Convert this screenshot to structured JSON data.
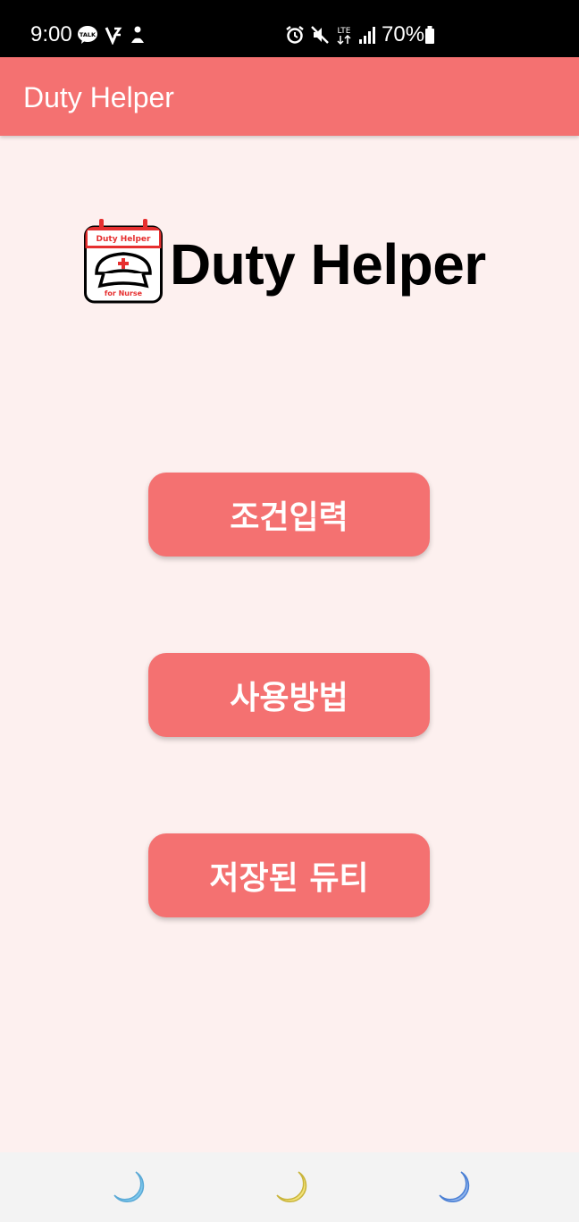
{
  "status_bar": {
    "time": "9:00",
    "battery": "70%",
    "icons": [
      "kakaotalk-icon",
      "v-app-icon",
      "person-icon",
      "alarm-icon",
      "mute-icon",
      "lte-icon",
      "signal-icon",
      "battery-icon"
    ],
    "lte_label": "LTE"
  },
  "app_bar": {
    "title": "Duty Helper"
  },
  "hero": {
    "logo": {
      "top_text": "Duty Helper",
      "bottom_text": "for Nurse"
    },
    "title": "Duty Helper"
  },
  "menu": {
    "buttons": [
      {
        "label": "조건입력"
      },
      {
        "label": "사용방법"
      },
      {
        "label": "저장된 듀티"
      }
    ]
  },
  "nav_bar": {
    "icons": [
      "moon-icon-left",
      "moon-icon-center",
      "moon-icon-right"
    ],
    "colors": [
      "#7ec8ec",
      "#e8d35a",
      "#4a7fd4"
    ]
  },
  "colors": {
    "accent": "#f47171",
    "background": "#fdf0ef",
    "status_bar": "#000000"
  }
}
